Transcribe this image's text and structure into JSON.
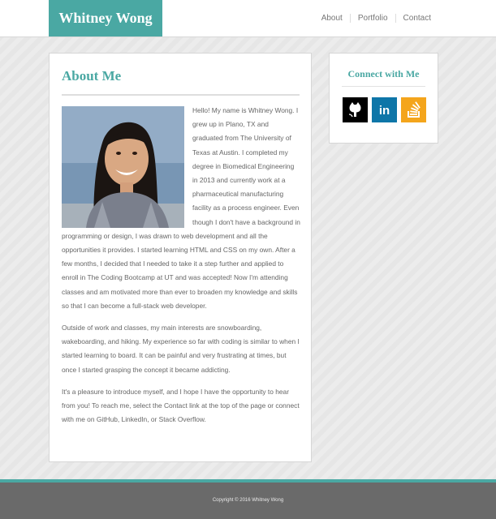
{
  "header": {
    "brand": "Whitney Wong",
    "nav": [
      {
        "label": "About"
      },
      {
        "label": "Portfolio"
      },
      {
        "label": "Contact"
      }
    ]
  },
  "about": {
    "title": "About Me",
    "paragraphs": [
      "Hello! My name is Whitney Wong. I grew up in Plano, TX and graduated from The University of Texas at Austin. I completed my degree in Biomedical Engineering in 2013 and currently work at a pharmaceutical manufacturing facility as a process engineer. Even though I don't have a background in programming or design, I was drawn to web development and all the opportunities it provides. I started learning HTML and CSS on my own. After a few months, I decided that I needed to take it a step further and applied to enroll in The Coding Bootcamp at UT and was accepted! Now I'm attending classes and am motivated more than ever to broaden my knowledge and skills so that I can become a full-stack web developer.",
      "Outside of work and classes, my main interests are snowboarding, wakeboarding, and hiking. My experience so far with coding is similar to when I started learning to board. It can be painful and very frustrating at times, but once I started grasping the concept it became addicting.",
      "It's a pleasure to introduce myself, and I hope I have the opportunity to hear from you! To reach me, select the Contact link at the top of the page or connect with me on GitHub, LinkedIn, or Stack Overflow."
    ]
  },
  "sidebar": {
    "title": "Connect with Me",
    "links": [
      {
        "icon": "github-icon",
        "color": "#000000"
      },
      {
        "icon": "linkedin-icon",
        "color": "#0e76a8",
        "glyph": "in"
      },
      {
        "icon": "stackoverflow-icon",
        "color": "#f4a51c"
      }
    ]
  },
  "footer": {
    "copyright": "Copyright © 2016 Whitney Wong"
  },
  "colors": {
    "accent": "#4aa8a3",
    "footer": "#6a6a6a",
    "background": "#e6e6e6"
  }
}
